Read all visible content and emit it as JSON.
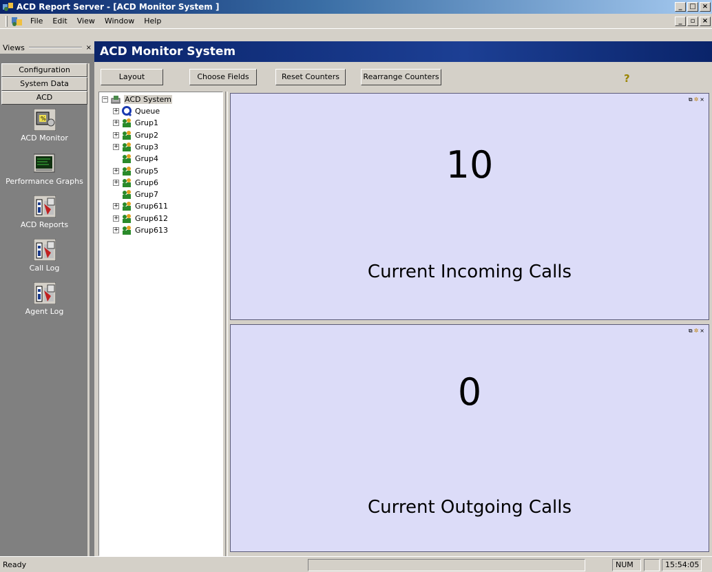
{
  "window": {
    "title": "ACD Report Server - [ACD Monitor System ]",
    "controls": [
      "_",
      "□",
      "×"
    ]
  },
  "menubar": {
    "items": [
      "File",
      "Edit",
      "View",
      "Window",
      "Help"
    ],
    "mdi_controls": [
      "_",
      "▫",
      "×"
    ]
  },
  "views": {
    "header": "Views",
    "close": "×",
    "groups": [
      "Configuration",
      "System Data",
      "ACD"
    ],
    "items": [
      {
        "label": "ACD Monitor",
        "icon": "acd-monitor-icon"
      },
      {
        "label": "Performance Graphs",
        "icon": "performance-graphs-icon"
      },
      {
        "label": "ACD Reports",
        "icon": "report-icon"
      },
      {
        "label": "Call Log",
        "icon": "report-icon"
      },
      {
        "label": "Agent Log",
        "icon": "report-icon"
      }
    ]
  },
  "main": {
    "title": "ACD Monitor System"
  },
  "toolbar": {
    "layout": "Layout",
    "choose_fields": "Choose Fields",
    "reset_counters": "Reset Counters",
    "rearrange_counters": "Rearrange Counters",
    "help": "?"
  },
  "tree": {
    "root": "ACD System",
    "nodes": [
      {
        "label": "Queue",
        "expandable": true
      },
      {
        "label": "Grup1",
        "expandable": true
      },
      {
        "label": "Grup2",
        "expandable": true
      },
      {
        "label": "Grup3",
        "expandable": true
      },
      {
        "label": "Grup4",
        "expandable": false
      },
      {
        "label": "Grup5",
        "expandable": true
      },
      {
        "label": "Grup6",
        "expandable": true
      },
      {
        "label": "Grup7",
        "expandable": false
      },
      {
        "label": "Grup611",
        "expandable": true
      },
      {
        "label": "Grup612",
        "expandable": true
      },
      {
        "label": "Grup613",
        "expandable": true
      }
    ]
  },
  "counters": [
    {
      "value": "10",
      "label": "Current Incoming Calls"
    },
    {
      "value": "0",
      "label": "Current Outgoing Calls"
    }
  ],
  "statusbar": {
    "text": "Ready",
    "num": "NUM",
    "time": "15:54:05"
  },
  "colors": {
    "counter_bg": "#dcdcf8",
    "header_bg": "#0a246a",
    "views_bg": "#808080"
  }
}
